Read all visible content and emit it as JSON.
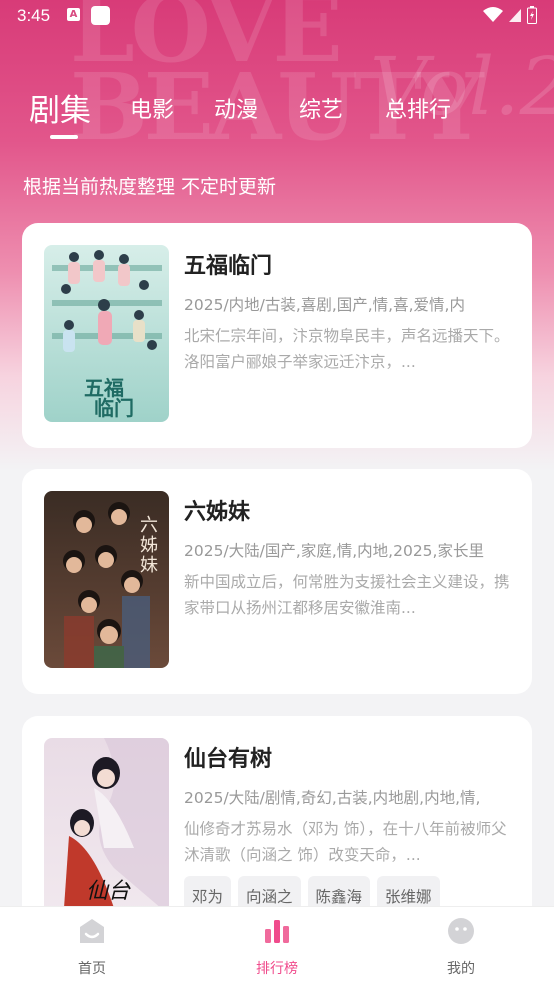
{
  "status_bar": {
    "time": "3:45",
    "badge_letter": "A"
  },
  "tabs": [
    {
      "label": "剧集",
      "active": true
    },
    {
      "label": "电影",
      "active": false
    },
    {
      "label": "动漫",
      "active": false
    },
    {
      "label": "综艺",
      "active": false
    },
    {
      "label": "总排行",
      "active": false
    }
  ],
  "subtitle": "根据当前热度整理 不定时更新",
  "cards": [
    {
      "title": "五福临门",
      "tags": "2025/内地/古装,喜剧,国产,情,喜,爱情,内",
      "desc": "北宋仁宗年间，汴京物阜民丰，声名远播天下。洛阳富户郦娘子举家远迁汴京，...",
      "poster_text": "五福临门",
      "cast": []
    },
    {
      "title": "六姊妹",
      "tags": "2025/大陆/国产,家庭,情,内地,2025,家长里",
      "desc": "新中国成立后，何常胜为支援社会主义建设，携家带口从扬州江都移居安徽淮南...",
      "poster_text": "六姊妹",
      "cast": []
    },
    {
      "title": "仙台有树",
      "tags": "2025/大陆/剧情,奇幻,古装,内地剧,内地,情,",
      "desc": "仙修奇才苏易水（邓为 饰），在十八年前被师父沐清歌（向涵之 饰）改变天命，...",
      "poster_text": "仙台有树",
      "cast": [
        "邓为",
        "向涵之",
        "陈鑫海",
        "张维娜"
      ]
    }
  ],
  "bottom_nav": [
    {
      "label": "首页",
      "icon": "home-icon",
      "active": false
    },
    {
      "label": "排行榜",
      "icon": "ranking-icon",
      "active": true
    },
    {
      "label": "我的",
      "icon": "profile-icon",
      "active": false
    }
  ],
  "colors": {
    "accent": "#f04b8c",
    "hero_top": "#d83b78"
  }
}
